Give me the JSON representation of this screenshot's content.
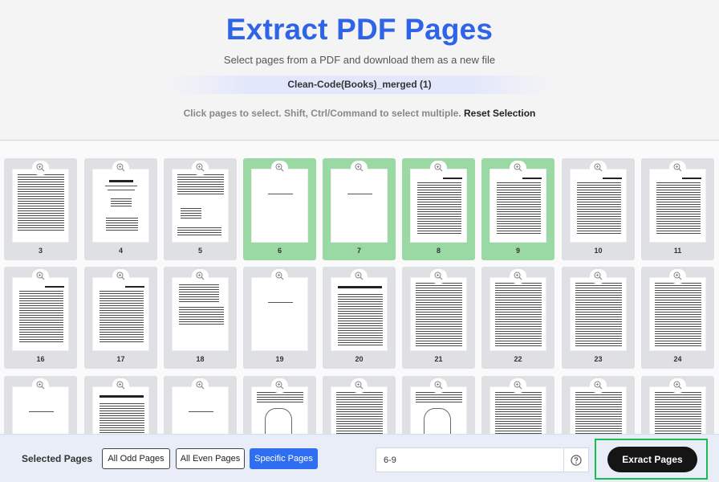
{
  "header": {
    "title": "Extract PDF Pages",
    "subtitle": "Select pages from a PDF and download them as a new file",
    "filename": "Clean-Code(Books)_merged (1)",
    "hint": "Click pages to select. Shift, Ctrl/Command to select multiple.",
    "reset_label": "Reset Selection"
  },
  "pages": [
    {
      "num": "3",
      "selected": false,
      "style": "text"
    },
    {
      "num": "4",
      "selected": false,
      "style": "cover"
    },
    {
      "num": "5",
      "selected": false,
      "style": "sparse"
    },
    {
      "num": "6",
      "selected": true,
      "style": "line"
    },
    {
      "num": "7",
      "selected": true,
      "style": "line"
    },
    {
      "num": "8",
      "selected": true,
      "style": "toc"
    },
    {
      "num": "9",
      "selected": true,
      "style": "toc"
    },
    {
      "num": "10",
      "selected": false,
      "style": "toc"
    },
    {
      "num": "11",
      "selected": false,
      "style": "toc"
    },
    {
      "num": "16",
      "selected": false,
      "style": "toc"
    },
    {
      "num": "17",
      "selected": false,
      "style": "toc"
    },
    {
      "num": "18",
      "selected": false,
      "style": "toc-short"
    },
    {
      "num": "19",
      "selected": false,
      "style": "line"
    },
    {
      "num": "20",
      "selected": false,
      "style": "heading"
    },
    {
      "num": "21",
      "selected": false,
      "style": "dense"
    },
    {
      "num": "22",
      "selected": false,
      "style": "dense"
    },
    {
      "num": "23",
      "selected": false,
      "style": "dense"
    },
    {
      "num": "24",
      "selected": false,
      "style": "dense"
    },
    {
      "num": "",
      "selected": false,
      "style": "line"
    },
    {
      "num": "",
      "selected": false,
      "style": "heading"
    },
    {
      "num": "",
      "selected": false,
      "style": "line"
    },
    {
      "num": "",
      "selected": false,
      "style": "image"
    },
    {
      "num": "",
      "selected": false,
      "style": "dense"
    },
    {
      "num": "",
      "selected": false,
      "style": "image"
    },
    {
      "num": "",
      "selected": false,
      "style": "dense"
    },
    {
      "num": "",
      "selected": false,
      "style": "dense"
    },
    {
      "num": "",
      "selected": false,
      "style": "dense"
    }
  ],
  "bottom": {
    "selected_label": "Selected Pages",
    "odd_label": "All Odd Pages",
    "even_label": "All Even Pages",
    "specific_label": "Specific Pages",
    "range_value": "6-9",
    "extract_label": "Exract Pages"
  },
  "colors": {
    "accent": "#2f64e8",
    "selected_card": "#9ad9a3",
    "highlight_border": "#1dbb53"
  },
  "icons": {
    "zoom": "zoom-in-icon",
    "help": "question-circle-icon"
  }
}
